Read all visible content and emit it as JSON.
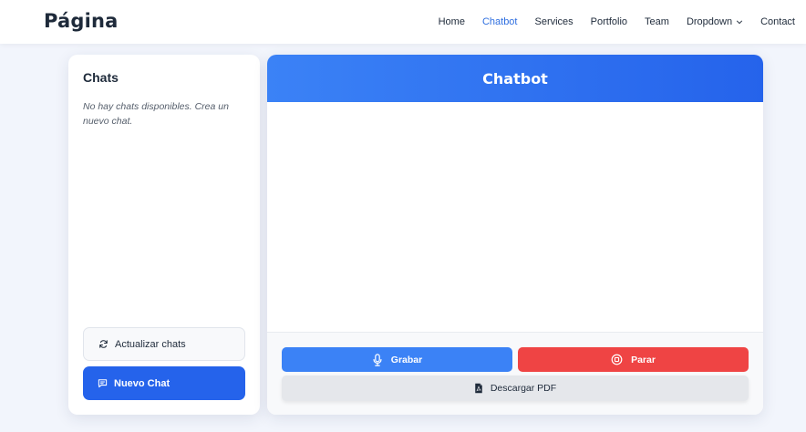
{
  "header": {
    "logo": "Página",
    "nav": [
      {
        "label": "Home"
      },
      {
        "label": "Chatbot"
      },
      {
        "label": "Services"
      },
      {
        "label": "Portfolio"
      },
      {
        "label": "Team"
      },
      {
        "label": "Dropdown"
      },
      {
        "label": "Contact"
      }
    ],
    "active_nav": "Chatbot"
  },
  "sidebar": {
    "title": "Chats",
    "empty_message": "No hay chats disponibles. Crea un nuevo chat.",
    "refresh_label": "Actualizar chats",
    "new_chat_label": "Nuevo Chat"
  },
  "chat": {
    "title": "Chatbot",
    "record_label": "Grabar",
    "stop_label": "Parar",
    "pdf_label": "Descargar PDF"
  },
  "colors": {
    "accent": "#2563eb",
    "record": "#3b82f6",
    "stop": "#ef4444",
    "page_bg": "#f2f5fc"
  },
  "icons": {
    "refresh": "refresh-icon",
    "new_chat": "message-icon",
    "record": "microphone-icon",
    "stop": "stop-icon",
    "pdf": "pdf-file-icon",
    "dropdown": "chevron-down-icon"
  }
}
